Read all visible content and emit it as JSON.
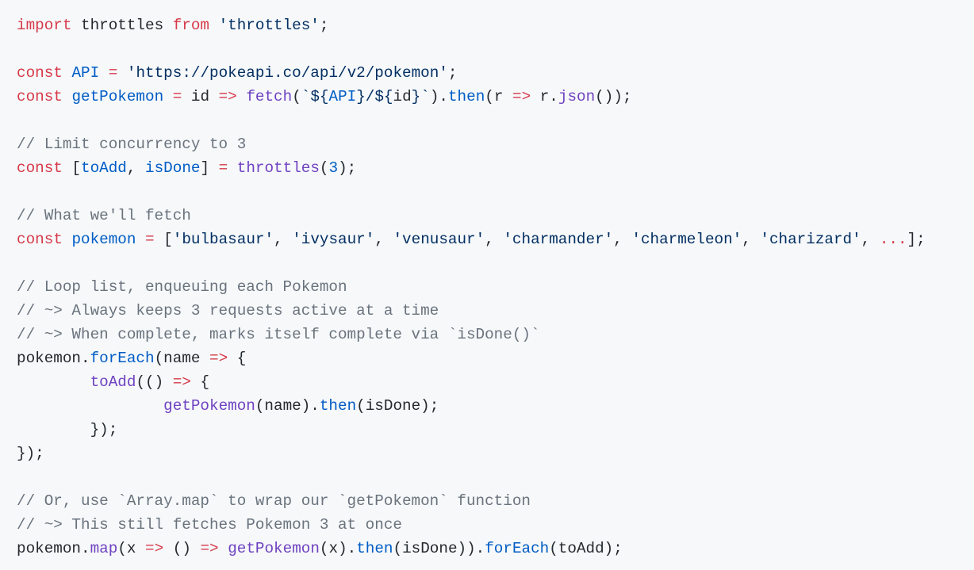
{
  "code_block": {
    "language": "javascript",
    "colors": {
      "background": "#f6f8fa",
      "keyword": "#d73a49",
      "string": "#032f62",
      "constant": "#005cc5",
      "function": "#6f42c1",
      "comment": "#6a737d",
      "plain": "#24292e"
    },
    "lines": [
      [
        [
          "kw",
          "import"
        ],
        [
          "pl",
          " throttles "
        ],
        [
          "kw",
          "from"
        ],
        [
          "pl",
          " "
        ],
        [
          "str",
          "'throttles'"
        ],
        [
          "pl",
          ";"
        ]
      ],
      [],
      [
        [
          "kw",
          "const"
        ],
        [
          "pl",
          " "
        ],
        [
          "ent",
          "API"
        ],
        [
          "pl",
          " "
        ],
        [
          "kw",
          "="
        ],
        [
          "pl",
          " "
        ],
        [
          "str",
          "'https://pokeapi.co/api/v2/pokemon'"
        ],
        [
          "pl",
          ";"
        ]
      ],
      [
        [
          "kw",
          "const"
        ],
        [
          "pl",
          " "
        ],
        [
          "ent",
          "getPokemon"
        ],
        [
          "pl",
          " "
        ],
        [
          "kw",
          "="
        ],
        [
          "pl",
          " id "
        ],
        [
          "kw",
          "=>"
        ],
        [
          "pl",
          " "
        ],
        [
          "fn",
          "fetch"
        ],
        [
          "pl",
          "("
        ],
        [
          "str",
          "`${"
        ],
        [
          "ent",
          "API"
        ],
        [
          "str",
          "}/${"
        ],
        [
          "pl",
          "id"
        ],
        [
          "str",
          "}`"
        ],
        [
          "pl",
          ")."
        ],
        [
          "ent",
          "then"
        ],
        [
          "pl",
          "(r "
        ],
        [
          "kw",
          "=>"
        ],
        [
          "pl",
          " r."
        ],
        [
          "fn",
          "json"
        ],
        [
          "pl",
          "());"
        ]
      ],
      [],
      [
        [
          "cm",
          "// Limit concurrency to 3"
        ]
      ],
      [
        [
          "kw",
          "const"
        ],
        [
          "pl",
          " ["
        ],
        [
          "ent",
          "toAdd"
        ],
        [
          "pl",
          ", "
        ],
        [
          "ent",
          "isDone"
        ],
        [
          "pl",
          "] "
        ],
        [
          "kw",
          "="
        ],
        [
          "pl",
          " "
        ],
        [
          "fn",
          "throttles"
        ],
        [
          "pl",
          "("
        ],
        [
          "ent",
          "3"
        ],
        [
          "pl",
          ");"
        ]
      ],
      [],
      [
        [
          "cm",
          "// What we'll fetch"
        ]
      ],
      [
        [
          "kw",
          "const"
        ],
        [
          "pl",
          " "
        ],
        [
          "ent",
          "pokemon"
        ],
        [
          "pl",
          " "
        ],
        [
          "kw",
          "="
        ],
        [
          "pl",
          " ["
        ],
        [
          "str",
          "'bulbasaur'"
        ],
        [
          "pl",
          ", "
        ],
        [
          "str",
          "'ivysaur'"
        ],
        [
          "pl",
          ", "
        ],
        [
          "str",
          "'venusaur'"
        ],
        [
          "pl",
          ", "
        ],
        [
          "str",
          "'charmander'"
        ],
        [
          "pl",
          ", "
        ],
        [
          "str",
          "'charmeleon'"
        ],
        [
          "pl",
          ", "
        ],
        [
          "str",
          "'charizard'"
        ],
        [
          "pl",
          ", "
        ],
        [
          "kw",
          "..."
        ],
        [
          "pl",
          "];"
        ]
      ],
      [],
      [
        [
          "cm",
          "// Loop list, enqueuing each Pokemon"
        ]
      ],
      [
        [
          "cm",
          "// ~> Always keeps 3 requests active at a time"
        ]
      ],
      [
        [
          "cm",
          "// ~> When complete, marks itself complete via `isDone()`"
        ]
      ],
      [
        [
          "pl",
          "pokemon."
        ],
        [
          "ent",
          "forEach"
        ],
        [
          "pl",
          "(name "
        ],
        [
          "kw",
          "=>"
        ],
        [
          "pl",
          " {"
        ]
      ],
      [
        [
          "pl",
          "        "
        ],
        [
          "fn",
          "toAdd"
        ],
        [
          "pl",
          "(() "
        ],
        [
          "kw",
          "=>"
        ],
        [
          "pl",
          " {"
        ]
      ],
      [
        [
          "pl",
          "                "
        ],
        [
          "fn",
          "getPokemon"
        ],
        [
          "pl",
          "(name)."
        ],
        [
          "ent",
          "then"
        ],
        [
          "pl",
          "(isDone);"
        ]
      ],
      [
        [
          "pl",
          "        });"
        ]
      ],
      [
        [
          "pl",
          "});"
        ]
      ],
      [],
      [
        [
          "cm",
          "// Or, use `Array.map` to wrap our `getPokemon` function"
        ]
      ],
      [
        [
          "cm",
          "// ~> This still fetches Pokemon 3 at once"
        ]
      ],
      [
        [
          "pl",
          "pokemon."
        ],
        [
          "fn",
          "map"
        ],
        [
          "pl",
          "(x "
        ],
        [
          "kw",
          "=>"
        ],
        [
          "pl",
          " () "
        ],
        [
          "kw",
          "=>"
        ],
        [
          "pl",
          " "
        ],
        [
          "fn",
          "getPokemon"
        ],
        [
          "pl",
          "(x)."
        ],
        [
          "ent",
          "then"
        ],
        [
          "pl",
          "(isDone))."
        ],
        [
          "ent",
          "forEach"
        ],
        [
          "pl",
          "(toAdd);"
        ]
      ]
    ]
  }
}
